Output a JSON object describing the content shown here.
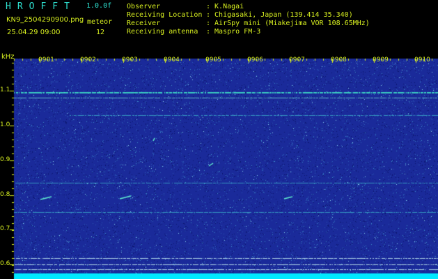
{
  "header": {
    "app_title": "HROFFT",
    "version": "1.0.0f",
    "file_name": "KN9_2504290900.png",
    "meteor_label": "meteor",
    "datetime": "25.04.29 09:00",
    "meteor_count": "12"
  },
  "station_info": [
    {
      "label": "Observer",
      "value": ": K.Nagai"
    },
    {
      "label": "Receiving Location",
      "value": ": Chigasaki, Japan (139.414 35.340)"
    },
    {
      "label": "Receiver",
      "value": ": AirSpy mini (Miakejima VOR 108.65MHz)"
    },
    {
      "label": "Receiving antenna",
      "value": ": Maspro FM-3"
    }
  ],
  "spectrogram": {
    "y_axis_unit": "kHz",
    "y_ticks": [
      "1.1",
      "1.0",
      "0.9",
      "0.8",
      "0.7",
      "0.6"
    ],
    "x_ticks": [
      "0901",
      "0902",
      "0903",
      "0904",
      "0905",
      "0906",
      "0907",
      "0908",
      "0909",
      "0910"
    ],
    "colors": {
      "background": "#1a2a9a",
      "noise": "#3a8ac8",
      "signal": "#40e8c8",
      "baseline": "#00e8ff",
      "grid": "#d8f020"
    }
  }
}
